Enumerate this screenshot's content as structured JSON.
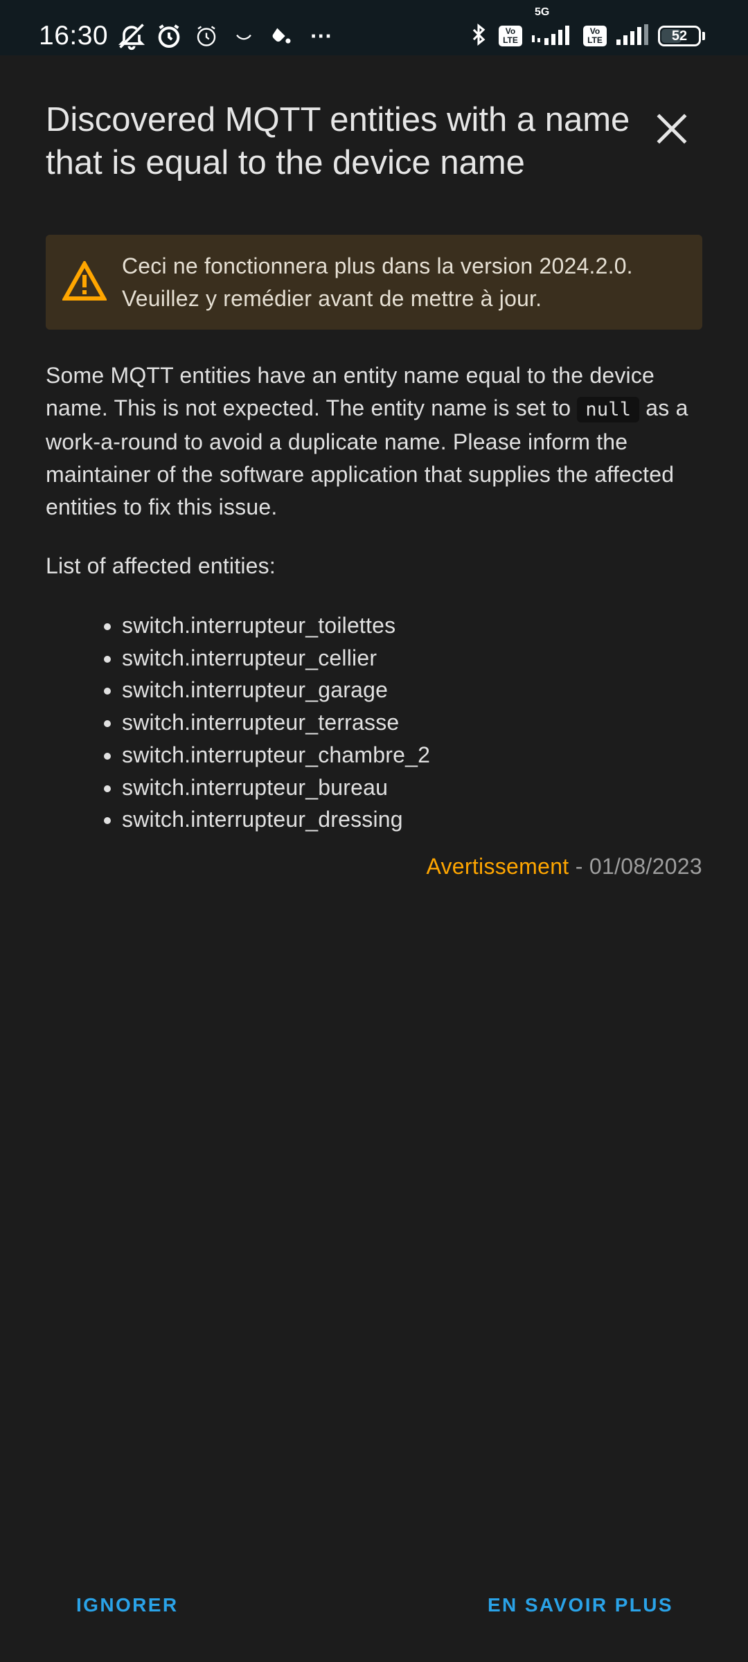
{
  "status_bar": {
    "time": "16:30",
    "network_label": "5G",
    "volte_label_top": "Vo",
    "volte_label_bottom": "LTE",
    "battery_level": "52",
    "more_indicator": "···",
    "left_icons": [
      "muted-bell-icon",
      "alarm-clock-icon",
      "alarm-clock-outline-icon",
      "smile-icon",
      "weather-icon",
      "more-dots-icon"
    ],
    "right_icons": [
      "bluetooth-icon",
      "volte-icon",
      "signal-5g-icon",
      "volte-icon",
      "signal-icon",
      "battery-icon"
    ]
  },
  "dialog": {
    "title": "Discovered MQTT entities with a name that is equal to the device name",
    "close_icon": "close-icon",
    "alert": {
      "icon": "warning-triangle-icon",
      "text": "Ceci ne fonctionnera plus dans la version 2024.2.0. Veuillez y remédier avant de mettre à jour.",
      "color": "#ffa600",
      "background": "#3a2f1e"
    },
    "description": {
      "part1": "Some MQTT entities have an entity name equal to the device name. This is not expected. The entity name is set to ",
      "code": "null",
      "part2": " as a work-a-round to avoid a duplicate name. Please inform the maintainer of the software application that supplies the affected entities to fix this issue."
    },
    "list_heading": "List of affected entities:",
    "entities": [
      "switch.interrupteur_toilettes",
      "switch.interrupteur_cellier",
      "switch.interrupteur_garage",
      "switch.interrupteur_terrasse",
      "switch.interrupteur_chambre_2",
      "switch.interrupteur_bureau",
      "switch.interrupteur_dressing"
    ],
    "severity": "Avertissement",
    "separator": " - ",
    "date": "01/08/2023",
    "actions": {
      "ignore": "IGNORER",
      "learn_more": "EN SAVOIR PLUS"
    }
  },
  "colors": {
    "background": "#1c1c1c",
    "accent": "#2aa3e8",
    "warning": "#ffa600",
    "status_bar": "#111b20"
  }
}
